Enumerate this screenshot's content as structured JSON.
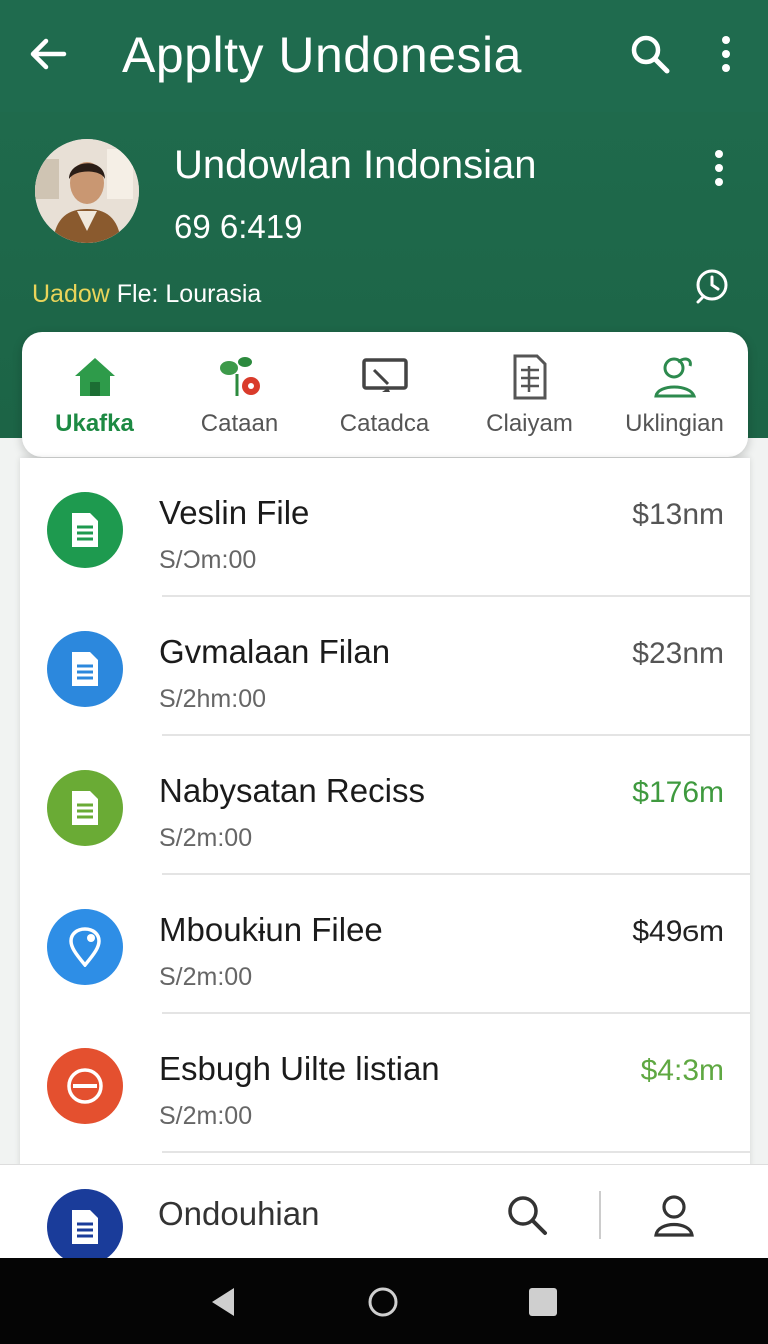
{
  "appbar": {
    "title": "Applty Undonesia",
    "back_icon": "arrow-left-icon",
    "search_icon": "search-icon",
    "more_icon": "more-vertical-icon"
  },
  "profile": {
    "name": "Undowlan Indonsian",
    "subtitle": "69 6:419",
    "file_label_highlight": "Uadow",
    "file_label_rest": " Fle:  Lourasia"
  },
  "tabs": [
    {
      "label": "Ukafka",
      "icon": "home-icon"
    },
    {
      "label": "Cataan",
      "icon": "plant-icon"
    },
    {
      "label": "Catadca",
      "icon": "cast-icon"
    },
    {
      "label": "Claiyam",
      "icon": "document-grid-icon"
    },
    {
      "label": "Uklingian",
      "icon": "person-plant-icon"
    }
  ],
  "list": [
    {
      "name": "Veslin File",
      "time": "S/Ͻm:00",
      "amount": "$13nm",
      "color": "#1e9a4f",
      "amount_color": "#555555",
      "icon": "document-icon"
    },
    {
      "name": "Gvmalaan Filan",
      "time": "S/2hm:00",
      "amount": "$23nm",
      "color": "#2c88dd",
      "amount_color": "#555555",
      "icon": "document-icon"
    },
    {
      "name": "Nabysatan Reciss",
      "time": "S/2m:00",
      "amount": "$176m",
      "color": "#6aab35",
      "amount_color": "#3f9a3f",
      "icon": "document-icon"
    },
    {
      "name": "Mboukɨun Filee",
      "time": "S/2m:00",
      "amount": "$49ϭm",
      "color": "#2e8ee6",
      "amount_color": "#222222",
      "icon": "location-pin-icon"
    },
    {
      "name": "Esbugh Uilte listian",
      "time": "S/2m:00",
      "amount": "$4:3m",
      "color": "#e4502f",
      "amount_color": "#5fa842",
      "icon": "warning-icon"
    }
  ],
  "bottom": {
    "label": "Ondouhian",
    "icon": "document-icon",
    "search_icon": "search-icon",
    "user_icon": "user-icon"
  },
  "colors": {
    "primary": "#1f6b4e",
    "accent_green": "#1d8a43"
  }
}
